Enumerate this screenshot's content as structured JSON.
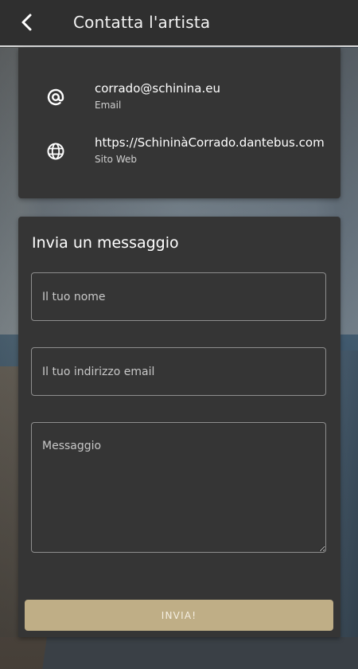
{
  "header": {
    "title": "Contatta l'artista",
    "back_icon": "chevron-left-icon"
  },
  "contact": {
    "email": {
      "icon": "at-sign-icon",
      "value": "corrado@schinina.eu",
      "label": "Email"
    },
    "website": {
      "icon": "globe-icon",
      "value": "https://SchininàCorrado.dantebus.com",
      "label": "Sito Web"
    }
  },
  "message_form": {
    "title": "Invia un messaggio",
    "name_placeholder": "Il tuo nome",
    "email_placeholder": "Il tuo indirizzo email",
    "message_placeholder": "Messaggio",
    "submit_label": "INVIA!"
  },
  "colors": {
    "header_bg": "#2f2f2f",
    "card_bg": "#353535",
    "accent_button": "#bfae86"
  }
}
